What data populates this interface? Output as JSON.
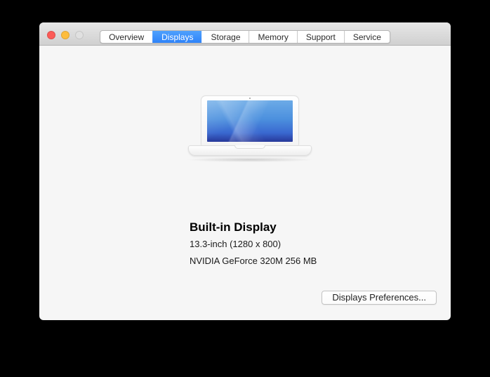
{
  "window_controls": {
    "close": "close",
    "minimize": "minimize",
    "zoom": "zoom (disabled)"
  },
  "tabs": [
    {
      "label": "Overview",
      "selected": false
    },
    {
      "label": "Displays",
      "selected": true
    },
    {
      "label": "Storage",
      "selected": false
    },
    {
      "label": "Memory",
      "selected": false
    },
    {
      "label": "Support",
      "selected": false
    },
    {
      "label": "Service",
      "selected": false
    }
  ],
  "display_info": {
    "title": "Built-in Display",
    "size_resolution": "13.3-inch (1280 x 800)",
    "graphics": "NVIDIA GeForce 320M 256 MB"
  },
  "buttons": {
    "displays_preferences": "Displays Preferences..."
  },
  "image": {
    "macbook_alt": "White MacBook with blue wallpaper"
  },
  "colors": {
    "accent_top": "#4fa0fd",
    "accent_bottom": "#2e83f9",
    "close": "#fc5b57",
    "minimize": "#fdbd3e",
    "zoom_disabled": "#e0e0e0",
    "titlebar_top": "#e7e7e7",
    "titlebar_bottom": "#d0d0d0",
    "content_bg": "#f6f6f6"
  }
}
